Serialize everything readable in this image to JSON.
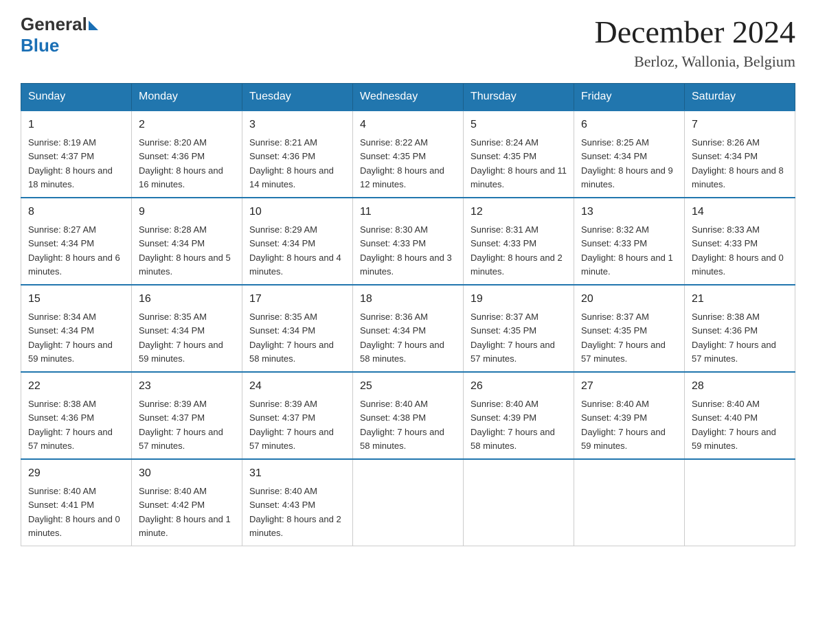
{
  "header": {
    "logo_general": "General",
    "logo_blue": "Blue",
    "month_year": "December 2024",
    "location": "Berloz, Wallonia, Belgium"
  },
  "columns": [
    "Sunday",
    "Monday",
    "Tuesday",
    "Wednesday",
    "Thursday",
    "Friday",
    "Saturday"
  ],
  "weeks": [
    [
      {
        "day": "1",
        "sunrise": "8:19 AM",
        "sunset": "4:37 PM",
        "daylight": "8 hours and 18 minutes."
      },
      {
        "day": "2",
        "sunrise": "8:20 AM",
        "sunset": "4:36 PM",
        "daylight": "8 hours and 16 minutes."
      },
      {
        "day": "3",
        "sunrise": "8:21 AM",
        "sunset": "4:36 PM",
        "daylight": "8 hours and 14 minutes."
      },
      {
        "day": "4",
        "sunrise": "8:22 AM",
        "sunset": "4:35 PM",
        "daylight": "8 hours and 12 minutes."
      },
      {
        "day": "5",
        "sunrise": "8:24 AM",
        "sunset": "4:35 PM",
        "daylight": "8 hours and 11 minutes."
      },
      {
        "day": "6",
        "sunrise": "8:25 AM",
        "sunset": "4:34 PM",
        "daylight": "8 hours and 9 minutes."
      },
      {
        "day": "7",
        "sunrise": "8:26 AM",
        "sunset": "4:34 PM",
        "daylight": "8 hours and 8 minutes."
      }
    ],
    [
      {
        "day": "8",
        "sunrise": "8:27 AM",
        "sunset": "4:34 PM",
        "daylight": "8 hours and 6 minutes."
      },
      {
        "day": "9",
        "sunrise": "8:28 AM",
        "sunset": "4:34 PM",
        "daylight": "8 hours and 5 minutes."
      },
      {
        "day": "10",
        "sunrise": "8:29 AM",
        "sunset": "4:34 PM",
        "daylight": "8 hours and 4 minutes."
      },
      {
        "day": "11",
        "sunrise": "8:30 AM",
        "sunset": "4:33 PM",
        "daylight": "8 hours and 3 minutes."
      },
      {
        "day": "12",
        "sunrise": "8:31 AM",
        "sunset": "4:33 PM",
        "daylight": "8 hours and 2 minutes."
      },
      {
        "day": "13",
        "sunrise": "8:32 AM",
        "sunset": "4:33 PM",
        "daylight": "8 hours and 1 minute."
      },
      {
        "day": "14",
        "sunrise": "8:33 AM",
        "sunset": "4:33 PM",
        "daylight": "8 hours and 0 minutes."
      }
    ],
    [
      {
        "day": "15",
        "sunrise": "8:34 AM",
        "sunset": "4:34 PM",
        "daylight": "7 hours and 59 minutes."
      },
      {
        "day": "16",
        "sunrise": "8:35 AM",
        "sunset": "4:34 PM",
        "daylight": "7 hours and 59 minutes."
      },
      {
        "day": "17",
        "sunrise": "8:35 AM",
        "sunset": "4:34 PM",
        "daylight": "7 hours and 58 minutes."
      },
      {
        "day": "18",
        "sunrise": "8:36 AM",
        "sunset": "4:34 PM",
        "daylight": "7 hours and 58 minutes."
      },
      {
        "day": "19",
        "sunrise": "8:37 AM",
        "sunset": "4:35 PM",
        "daylight": "7 hours and 57 minutes."
      },
      {
        "day": "20",
        "sunrise": "8:37 AM",
        "sunset": "4:35 PM",
        "daylight": "7 hours and 57 minutes."
      },
      {
        "day": "21",
        "sunrise": "8:38 AM",
        "sunset": "4:36 PM",
        "daylight": "7 hours and 57 minutes."
      }
    ],
    [
      {
        "day": "22",
        "sunrise": "8:38 AM",
        "sunset": "4:36 PM",
        "daylight": "7 hours and 57 minutes."
      },
      {
        "day": "23",
        "sunrise": "8:39 AM",
        "sunset": "4:37 PM",
        "daylight": "7 hours and 57 minutes."
      },
      {
        "day": "24",
        "sunrise": "8:39 AM",
        "sunset": "4:37 PM",
        "daylight": "7 hours and 57 minutes."
      },
      {
        "day": "25",
        "sunrise": "8:40 AM",
        "sunset": "4:38 PM",
        "daylight": "7 hours and 58 minutes."
      },
      {
        "day": "26",
        "sunrise": "8:40 AM",
        "sunset": "4:39 PM",
        "daylight": "7 hours and 58 minutes."
      },
      {
        "day": "27",
        "sunrise": "8:40 AM",
        "sunset": "4:39 PM",
        "daylight": "7 hours and 59 minutes."
      },
      {
        "day": "28",
        "sunrise": "8:40 AM",
        "sunset": "4:40 PM",
        "daylight": "7 hours and 59 minutes."
      }
    ],
    [
      {
        "day": "29",
        "sunrise": "8:40 AM",
        "sunset": "4:41 PM",
        "daylight": "8 hours and 0 minutes."
      },
      {
        "day": "30",
        "sunrise": "8:40 AM",
        "sunset": "4:42 PM",
        "daylight": "8 hours and 1 minute."
      },
      {
        "day": "31",
        "sunrise": "8:40 AM",
        "sunset": "4:43 PM",
        "daylight": "8 hours and 2 minutes."
      },
      null,
      null,
      null,
      null
    ]
  ]
}
